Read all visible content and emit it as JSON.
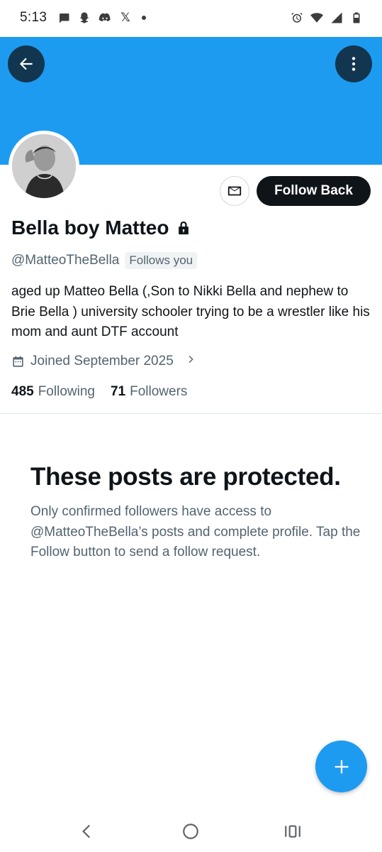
{
  "status_bar": {
    "time": "5:13",
    "left_icons": [
      "chat-bubble-icon",
      "snapchat-icon",
      "discord-icon",
      "x-icon",
      "dot-icon"
    ],
    "right_icons": [
      "alarm-icon",
      "wifi-icon",
      "signal-icon",
      "battery-icon"
    ],
    "x_glyph": "𝕏"
  },
  "header": {
    "banner_color": "#1d9bf0",
    "back_icon": "arrow-left-icon",
    "more_icon": "more-vertical-icon"
  },
  "profile": {
    "display_name": "Bella boy Matteo",
    "protected_icon": "lock-icon",
    "handle": "@MatteoTheBella",
    "follows_you_badge": "Follows you",
    "bio": "aged up Matteo Bella (,Son to Nikki Bella and nephew to Brie Bella ) university schooler trying to be a wrestler like his mom and aunt  DTF account",
    "joined": "Joined September 2025",
    "following_count": "485",
    "following_label": "Following",
    "followers_count": "71",
    "followers_label": "Followers"
  },
  "actions": {
    "message_icon": "mail-icon",
    "follow_back_label": "Follow Back"
  },
  "protected_notice": {
    "title": "These posts are protected.",
    "text": "Only confirmed followers have access to @MatteoTheBella’s posts and complete profile. Tap the Follow button to send a follow request."
  },
  "fab": {
    "icon": "plus-icon",
    "color": "#1d9bf0"
  },
  "nav_bar": {
    "back_icon": "nav-back-icon",
    "home_icon": "nav-home-icon",
    "recents_icon": "nav-recents-icon"
  }
}
